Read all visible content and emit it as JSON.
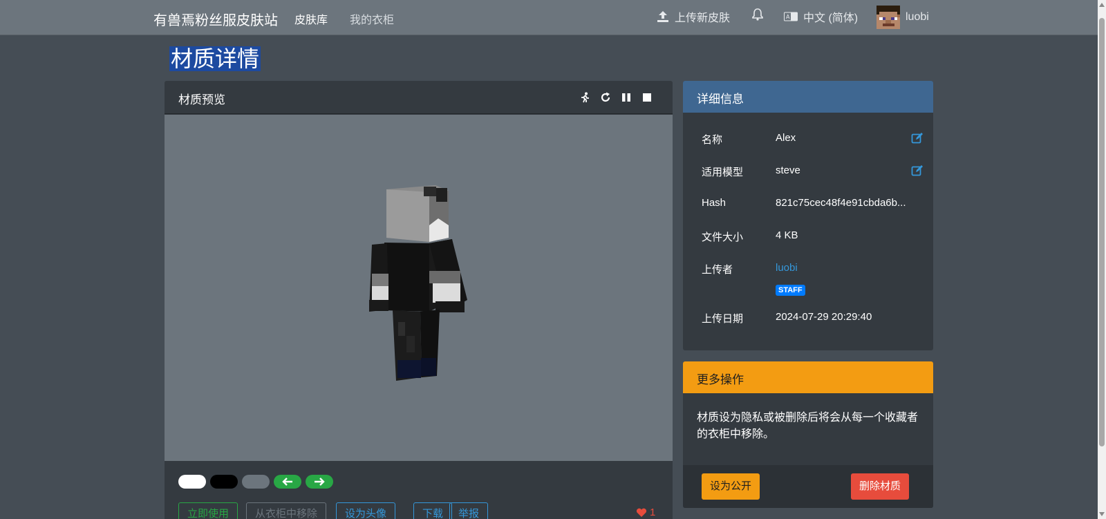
{
  "navbar": {
    "brand": "有兽焉粉丝服皮肤站",
    "links": [
      "皮肤库",
      "我的衣柜"
    ],
    "upload": "上传新皮肤",
    "language": "中文 (简体)",
    "username": "luobi"
  },
  "page": {
    "title": "材质详情"
  },
  "preview_card": {
    "title": "材质预览",
    "controls": [
      "run-icon",
      "redo-icon",
      "pause-icon",
      "stop-icon"
    ],
    "buttons": [
      "立即使用",
      "从衣柜中移除",
      "设为头像",
      "下载",
      "举报"
    ],
    "likes": "1"
  },
  "info_card": {
    "title": "详细信息",
    "rows": [
      {
        "label": "名称",
        "value": "Alex"
      },
      {
        "label": "适用模型",
        "value": "steve"
      },
      {
        "label": "Hash",
        "value": "821c75cec48f4e91cbda6b..."
      },
      {
        "label": "文件大小",
        "value": "4 KB"
      },
      {
        "label": "上传者",
        "value": "luobi"
      },
      {
        "label": "上传日期",
        "value": "2024-07-29 20:29:40"
      }
    ],
    "badge": "STAFF"
  },
  "more_card": {
    "title": "更多操作",
    "text": "材质设为隐私或被删除后将会从每一个收藏者的衣柜中移除。",
    "btn_public": "设为公开",
    "btn_delete": "删除材质"
  },
  "colors": {
    "navbar": "#6c757d",
    "background": "#454d55",
    "card": "#343a40",
    "info_header": "#3f6791",
    "more_header": "#f39c12",
    "link": "#3498db",
    "danger": "#e74c3c",
    "success": "#28a745"
  }
}
